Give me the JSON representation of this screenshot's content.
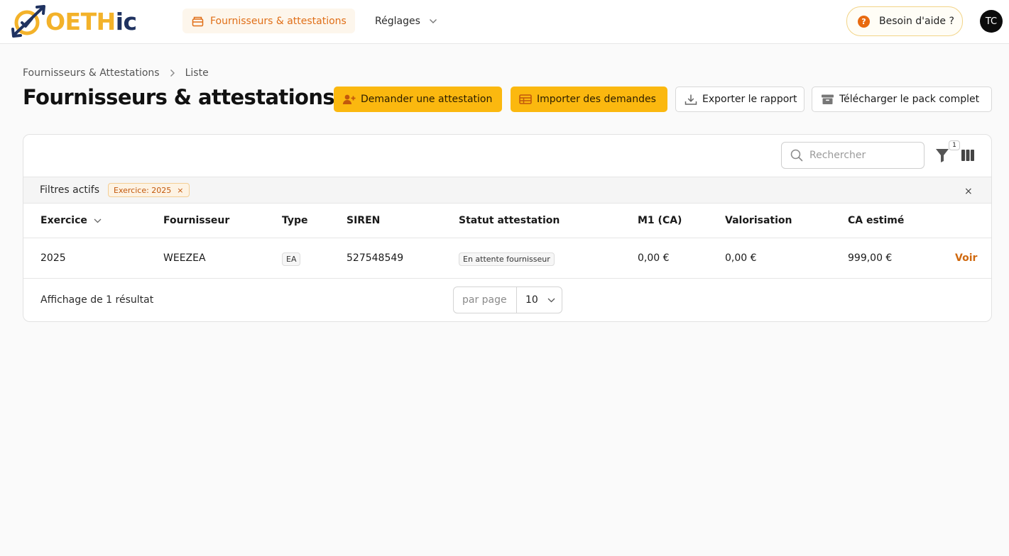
{
  "app": {
    "logo_text_yellow": "OETH",
    "logo_text_blue": "ic",
    "brand_colors": {
      "yellow": "#f3b22a",
      "navy": "#1f3260",
      "accent": "#e06f18"
    }
  },
  "nav": {
    "active_label": "Fournisseurs & attestations",
    "active_icon": "box-icon",
    "settings_label": "Réglages",
    "help_label": "Besoin d'aide ?",
    "help_icon": "question-circle-icon",
    "avatar_initials": "TC"
  },
  "breadcrumb": {
    "items": [
      "Fournisseurs & Attestations",
      "Liste"
    ]
  },
  "page": {
    "title": "Fournisseurs & attestations"
  },
  "actions": {
    "request_label": "Demander une attestation",
    "import_label": "Importer des demandes",
    "export_label": "Exporter le rapport",
    "download_label": "Télécharger le pack complet"
  },
  "toolbar": {
    "search_placeholder": "Rechercher",
    "filter_count": "1"
  },
  "filters": {
    "label": "Filtres actifs",
    "chips": [
      {
        "text": "Exercice: 2025"
      }
    ],
    "clear_symbol": "×"
  },
  "table": {
    "columns": [
      "Exercice",
      "Fournisseur",
      "Type",
      "SIREN",
      "Statut attestation",
      "M1 (CA)",
      "Valorisation",
      "CA estimé"
    ],
    "rows": [
      {
        "exercice": "2025",
        "fournisseur": "WEEZEA",
        "type": "EA",
        "siren": "527548549",
        "statut": "En attente fournisseur",
        "m1": "0,00 €",
        "valorisation": "0,00 €",
        "ca_estime": "999,00 €",
        "action": "Voir"
      }
    ]
  },
  "pagination": {
    "result_text": "Affichage de 1 résultat",
    "per_page_label": "par page",
    "per_page_value": "10"
  }
}
